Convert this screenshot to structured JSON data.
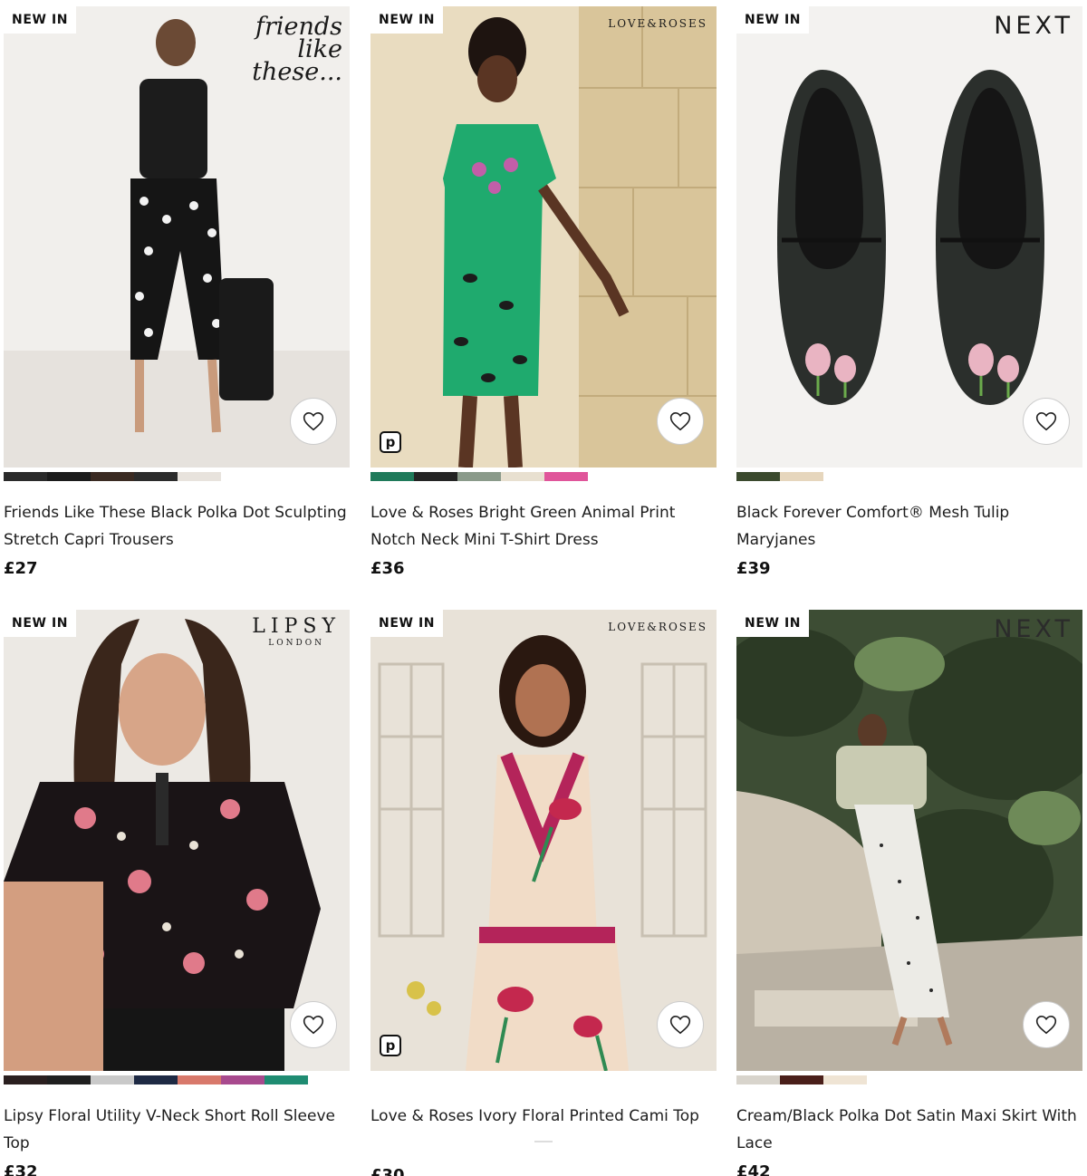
{
  "products": [
    {
      "badge": "NEW IN",
      "brand": "friends like these...",
      "title": "Friends Like These Black Polka Dot Sculpting Stretch Capri Trousers",
      "price": "£27",
      "swatches": [
        "#2a2a2a",
        "#1b1b1b",
        "#3a2a22",
        "#2b2b2b",
        "#e8e3dd"
      ],
      "icons": [
        "heart-icon"
      ]
    },
    {
      "badge": "NEW IN",
      "brand": "LOVE&ROSES",
      "title": "Love & Roses Bright Green Animal Print Notch Neck Mini T-Shirt Dress",
      "price": "£36",
      "swatches": [
        "#1f7a5a",
        "#242424",
        "#8a9a8a",
        "#e8e0d0",
        "#e0559a"
      ],
      "icons": [
        "heart-icon",
        "p-icon"
      ]
    },
    {
      "badge": "NEW IN",
      "brand": "NEXT",
      "title": "Black Forever Comfort® Mesh Tulip Maryjanes",
      "price": "£39",
      "swatches": [
        "#3b4a2e",
        "#e6d6bd"
      ],
      "icons": [
        "heart-icon"
      ]
    },
    {
      "badge": "NEW IN",
      "brand": "LIPSY",
      "brand_sub": "LONDON",
      "title": "Lipsy Floral Utility V-Neck Short Roll Sleeve Top",
      "price": "£32",
      "swatches": [
        "#2a1f1f",
        "#1f1f1f",
        "#c9c9c9",
        "#1e2a44",
        "#d8796b",
        "#a84a8e",
        "#1f8c72"
      ],
      "icons": [
        "heart-icon"
      ]
    },
    {
      "badge": "NEW IN",
      "brand": "LOVE&ROSES",
      "title": "Love & Roses Ivory Floral Printed Cami Top",
      "price": "£30",
      "swatches": [],
      "icons": [
        "heart-icon",
        "p-icon"
      ]
    },
    {
      "badge": "NEW IN",
      "brand": "NEXT",
      "title": "Cream/Black Polka Dot Satin Maxi Skirt With Lace",
      "price": "£42",
      "swatches": [
        "#d8d4cc",
        "#4a1f1a",
        "#efe4d4"
      ],
      "icons": [
        "heart-icon"
      ]
    }
  ],
  "p_icon_label": "p"
}
